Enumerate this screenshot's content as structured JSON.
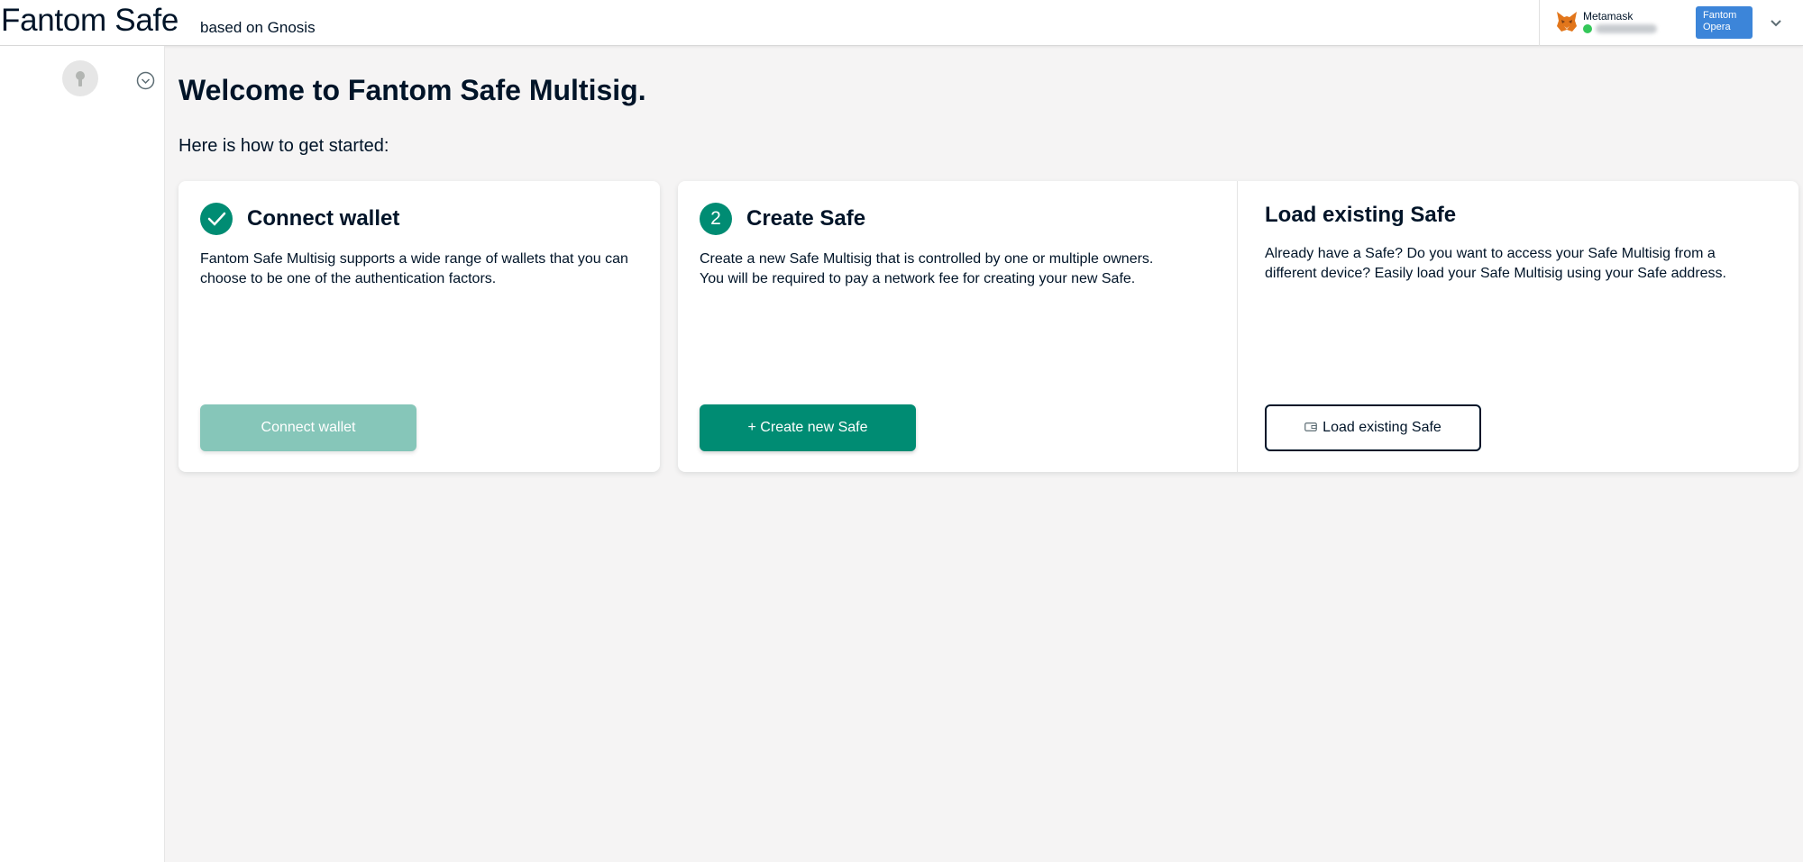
{
  "header": {
    "brand_title": "Fantom Safe",
    "brand_subtitle": "based on Gnosis",
    "wallet": {
      "provider_name": "Metamask",
      "status_color": "#34c759"
    },
    "network_badge": "Fantom Opera"
  },
  "main": {
    "welcome_title": "Welcome to Fantom Safe Multisig.",
    "intro_text": "Here is how to get started:",
    "cards": {
      "connect": {
        "title": "Connect wallet",
        "description": "Fantom Safe Multisig supports a wide range of wallets that you can choose to be one of the authentication factors.",
        "button_label": "Connect wallet"
      },
      "create": {
        "step": "2",
        "title": "Create Safe",
        "description_line1": "Create a new Safe Multisig that is controlled by one or multiple owners.",
        "description_line2": "You will be required to pay a network fee for creating your new Safe.",
        "button_label": "+ Create new Safe"
      },
      "load": {
        "title": "Load existing Safe",
        "description_line1": "Already have a Safe? Do you want to access your Safe Multisig from a",
        "description_line2": "different device? Easily load your Safe Multisig using your Safe address.",
        "button_label": "Load existing Safe"
      }
    }
  },
  "colors": {
    "accent": "#008c73",
    "accent_disabled": "#86c6b9",
    "network": "#3c85d9",
    "text": "#001428"
  },
  "icons": {
    "wallet_provider": "metamask-fox-icon",
    "header_toggle": "chevron-down-icon",
    "sidebar_avatar": "keyhole-icon",
    "sidebar_toggle": "chevron-circle-icon",
    "step_done": "check-icon",
    "load_button": "wallet-icon"
  }
}
